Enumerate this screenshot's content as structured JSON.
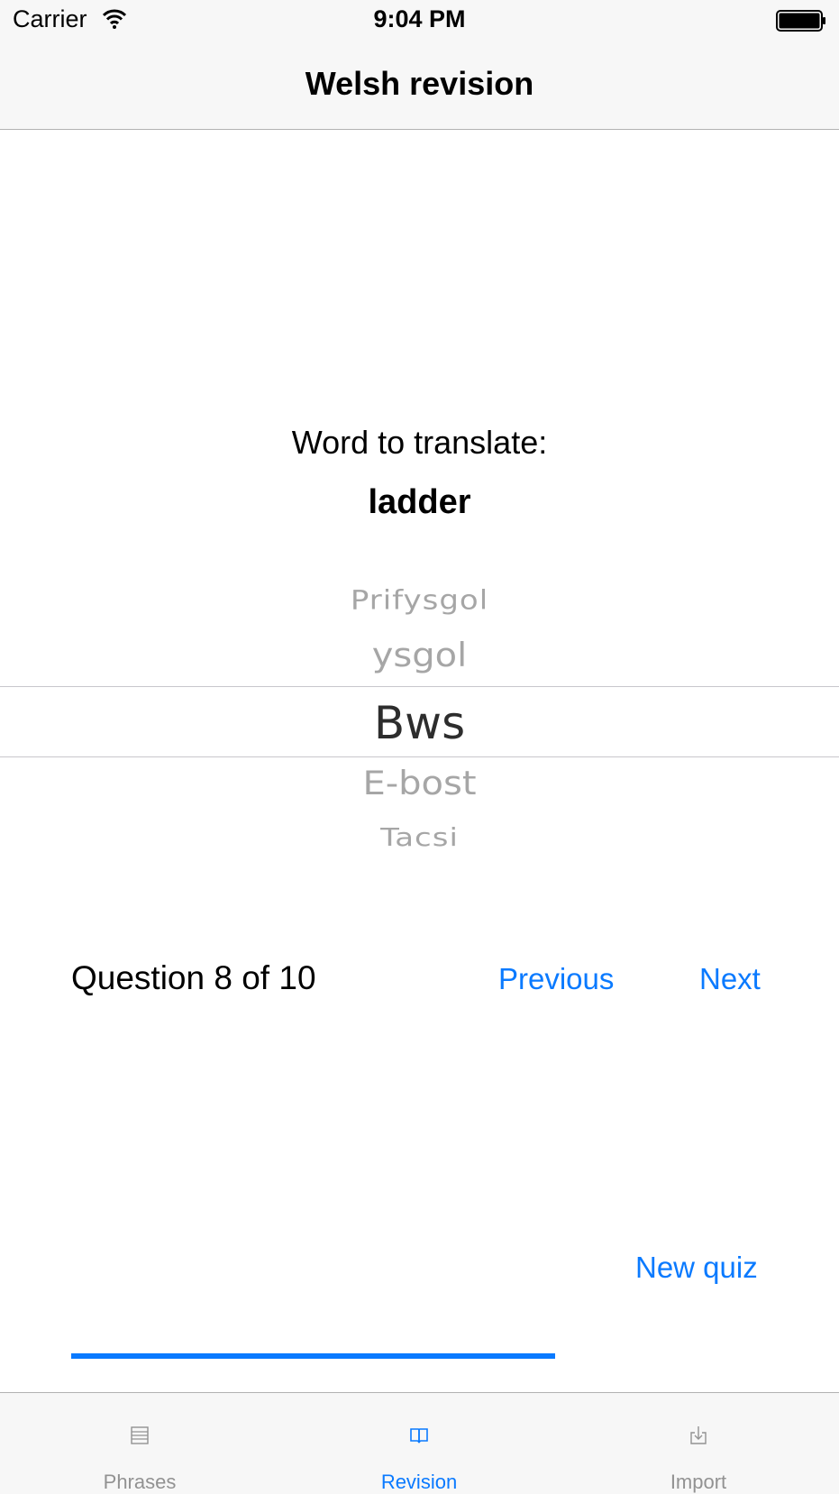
{
  "status_bar": {
    "carrier": "Carrier",
    "time": "9:04 PM"
  },
  "nav": {
    "title": "Welsh revision"
  },
  "prompt": {
    "label": "Word to translate:",
    "word": "ladder"
  },
  "picker": {
    "items": [
      "Prifysgol",
      "ysgol",
      "Bws",
      "E-bost",
      "Tacsi"
    ],
    "selected": "Bws"
  },
  "quiz": {
    "counter": "Question 8 of 10",
    "previous_label": "Previous",
    "next_label": "Next",
    "new_quiz_label": "New quiz",
    "progress": 0.7
  },
  "tabs": [
    {
      "label": "Phrases",
      "icon": "list-icon",
      "active": false
    },
    {
      "label": "Revision",
      "icon": "book-icon",
      "active": true
    },
    {
      "label": "Import",
      "icon": "import-icon",
      "active": false
    }
  ],
  "colors": {
    "accent": "#0a7aff",
    "inactive": "#929292",
    "bar_bg": "#f7f7f7"
  }
}
